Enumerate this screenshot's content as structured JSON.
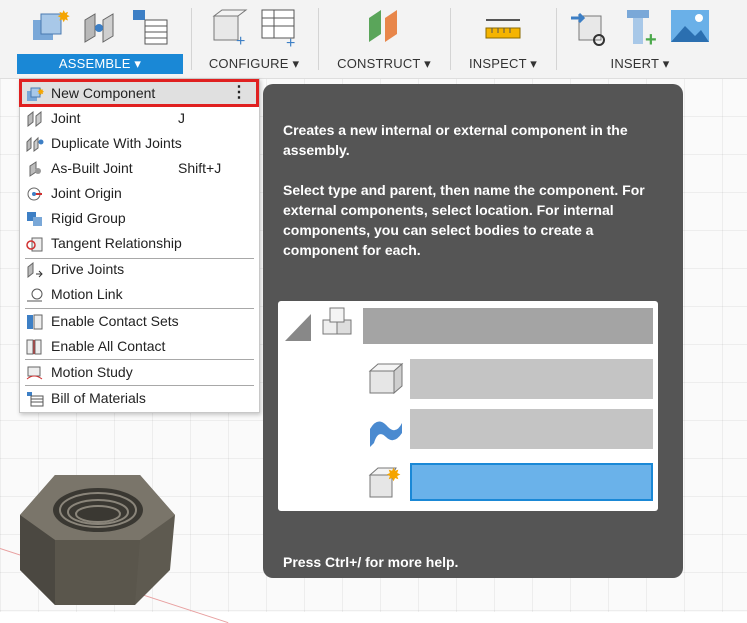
{
  "toolbar": {
    "groups": [
      {
        "label": "ASSEMBLE ▾",
        "active": true
      },
      {
        "label": "CONFIGURE ▾"
      },
      {
        "label": "CONSTRUCT ▾"
      },
      {
        "label": "INSPECT ▾"
      },
      {
        "label": "INSERT ▾"
      }
    ]
  },
  "menu": {
    "items": [
      {
        "label": "New Component",
        "shortcut": "",
        "icon": "new-component-icon"
      },
      {
        "label": "Joint",
        "shortcut": "J",
        "icon": "joint-icon"
      },
      {
        "label": "Duplicate With Joints",
        "shortcut": "",
        "icon": "duplicate-joints-icon"
      },
      {
        "label": "As-Built Joint",
        "shortcut": "Shift+J",
        "icon": "as-built-joint-icon"
      },
      {
        "label": "Joint Origin",
        "shortcut": "",
        "icon": "joint-origin-icon"
      },
      {
        "label": "Rigid Group",
        "shortcut": "",
        "icon": "rigid-group-icon"
      },
      {
        "label": "Tangent Relationship",
        "shortcut": "",
        "icon": "tangent-icon"
      },
      {
        "label": "Drive Joints",
        "shortcut": "",
        "icon": "drive-joints-icon"
      },
      {
        "label": "Motion Link",
        "shortcut": "",
        "icon": "motion-link-icon"
      },
      {
        "label": "Enable Contact Sets",
        "shortcut": "",
        "icon": "contact-sets-icon"
      },
      {
        "label": "Enable All Contact",
        "shortcut": "",
        "icon": "all-contact-icon"
      },
      {
        "label": "Motion Study",
        "shortcut": "",
        "icon": "motion-study-icon"
      },
      {
        "label": "Bill of Materials",
        "shortcut": "",
        "icon": "bom-icon"
      }
    ],
    "more_glyph": "⋮"
  },
  "tooltip": {
    "para1": "Creates a new internal or external component in the assembly.",
    "para2": "Select type and parent, then name the component. For external components, select location. For internal components, you can select bodies to create a component for each.",
    "footer": "Press Ctrl+/ for more help."
  },
  "colors": {
    "accent": "#1a88d6",
    "highlight_border": "#e02020",
    "tooltip_bg": "#555555"
  }
}
